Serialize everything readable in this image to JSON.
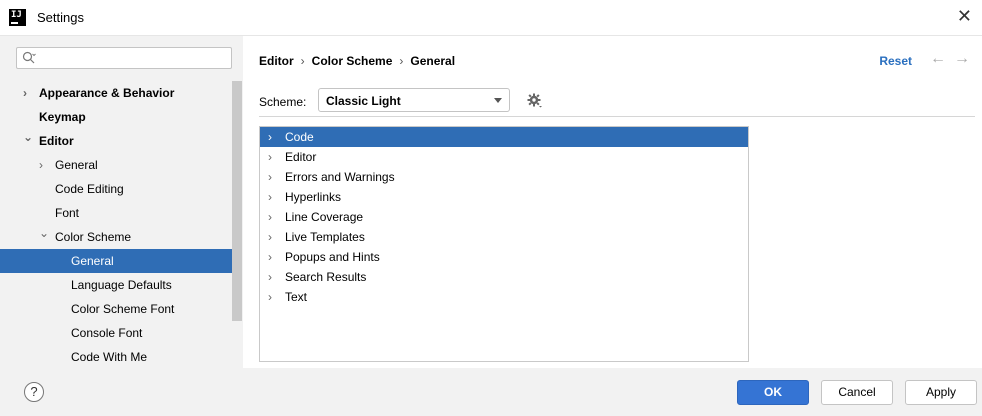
{
  "window": {
    "title": "Settings",
    "app_icon_text": "IJ"
  },
  "search": {
    "value": "",
    "placeholder": ""
  },
  "tree": [
    {
      "label": "Appearance & Behavior",
      "level": 0,
      "bold": true,
      "chevron": "right"
    },
    {
      "label": "Keymap",
      "level": 0,
      "bold": true,
      "chevron": ""
    },
    {
      "label": "Editor",
      "level": 0,
      "bold": true,
      "chevron": "down"
    },
    {
      "label": "General",
      "level": 1,
      "bold": false,
      "chevron": "right"
    },
    {
      "label": "Code Editing",
      "level": 1,
      "bold": false,
      "chevron": ""
    },
    {
      "label": "Font",
      "level": 1,
      "bold": false,
      "chevron": ""
    },
    {
      "label": "Color Scheme",
      "level": 1,
      "bold": false,
      "chevron": "down"
    },
    {
      "label": "General",
      "level": 2,
      "bold": false,
      "chevron": "",
      "selected": true
    },
    {
      "label": "Language Defaults",
      "level": 2,
      "bold": false,
      "chevron": ""
    },
    {
      "label": "Color Scheme Font",
      "level": 2,
      "bold": false,
      "chevron": ""
    },
    {
      "label": "Console Font",
      "level": 2,
      "bold": false,
      "chevron": ""
    },
    {
      "label": "Code With Me",
      "level": 2,
      "bold": false,
      "chevron": ""
    }
  ],
  "breadcrumb": [
    "Editor",
    "Color Scheme",
    "General"
  ],
  "header": {
    "reset_label": "Reset"
  },
  "scheme": {
    "label": "Scheme:",
    "value": "Classic Light"
  },
  "categories": [
    {
      "label": "Code",
      "selected": true
    },
    {
      "label": "Editor"
    },
    {
      "label": "Errors and Warnings"
    },
    {
      "label": "Hyperlinks"
    },
    {
      "label": "Line Coverage"
    },
    {
      "label": "Live Templates"
    },
    {
      "label": "Popups and Hints"
    },
    {
      "label": "Search Results"
    },
    {
      "label": "Text"
    }
  ],
  "buttons": {
    "help": "?",
    "ok": "OK",
    "cancel": "Cancel",
    "apply": "Apply"
  },
  "colors": {
    "selection": "#2f6db5",
    "accent_link": "#2a6fbf",
    "ok_button": "#3574d4"
  }
}
